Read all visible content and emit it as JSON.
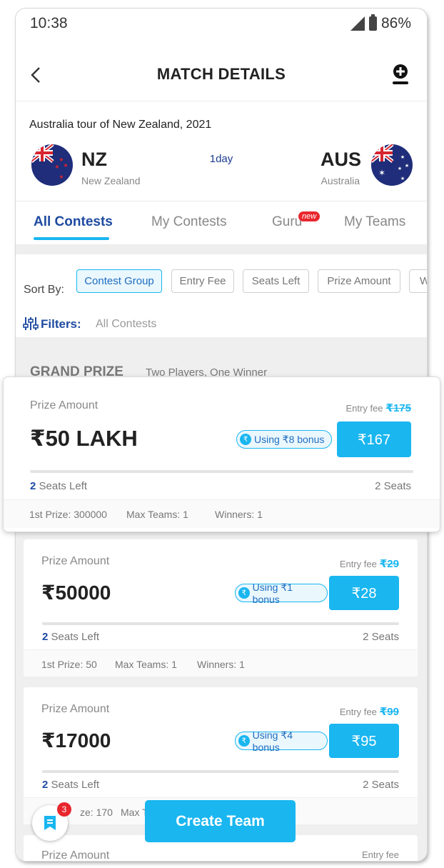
{
  "status_bar": {
    "time": "10:38",
    "battery": "86%"
  },
  "header": {
    "title": "MATCH DETAILS"
  },
  "match": {
    "tour": "Australia tour of New Zealand, 2021",
    "format": "1day",
    "team1": {
      "code": "NZ",
      "name": "New Zealand"
    },
    "team2": {
      "code": "AUS",
      "name": "Australia"
    }
  },
  "tabs": [
    {
      "label": "All Contests",
      "active": true
    },
    {
      "label": "My Contests"
    },
    {
      "label": "Guru",
      "badge": "new"
    },
    {
      "label": "My Teams"
    }
  ],
  "sort": {
    "label": "Sort By:",
    "chips": [
      "Contest Group",
      "Entry Fee",
      "Seats Left",
      "Prize Amount",
      "W"
    ]
  },
  "filters": {
    "label": "Filters:",
    "value": "All Contests"
  },
  "group": {
    "title": "GRAND PRIZE",
    "subtitle": "Two Players, One Winner"
  },
  "contests": [
    {
      "prize_label": "Prize Amount",
      "prize": "₹50 LAKH",
      "entry_label": "Entry fee",
      "entry_original": "₹175",
      "bonus": "Using ₹8 bonus",
      "price": "₹167",
      "seats_left_count": "2",
      "seats_left_text": " Seats Left",
      "seats_total": "2 Seats",
      "first_prize": "1st Prize: 300000",
      "max_teams": "Max Teams: 1",
      "winners": "Winners: 1"
    },
    {
      "prize_label": "Prize Amount",
      "prize": "₹50000",
      "entry_label": "Entry fee",
      "entry_original": "₹29",
      "bonus": "Using ₹1 bonus",
      "price": "₹28",
      "seats_left_count": "2",
      "seats_left_text": " Seats Left",
      "seats_total": "2 Seats",
      "first_prize": "1st Prize: 50",
      "max_teams": "Max Teams: 1",
      "winners": "Winners: 1"
    },
    {
      "prize_label": "Prize Amount",
      "prize": "₹17000",
      "entry_label": "Entry fee",
      "entry_original": "₹99",
      "bonus": "Using ₹4 bonus",
      "price": "₹95",
      "seats_left_count": "2",
      "seats_left_text": " Seats Left",
      "seats_total": "2 Seats",
      "first_prize": "ze: 170",
      "max_teams": "Max T"
    },
    {
      "prize_label": "Prize Amount",
      "entry_label": "Entry fee"
    }
  ],
  "fab": {
    "badge": "3"
  },
  "create_team": "Create Team",
  "colors": {
    "accent": "#19b6f0",
    "brand_blue": "#1e4aa0",
    "badge_red": "#e8262d"
  }
}
